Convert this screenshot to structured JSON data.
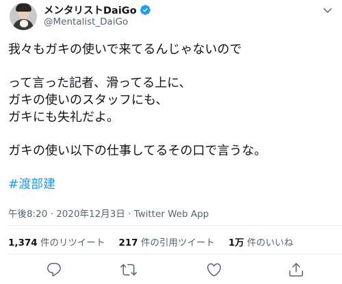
{
  "author": {
    "display_name": "メンタリストDaiGo",
    "handle": "@Mentalist_DaiGo",
    "verified": true
  },
  "tweet": {
    "lines": [
      "我々もガキの使いで来てるんじゃないので",
      "",
      "って言った記者、滑ってる上に、",
      "ガキの使いのスタッフにも、",
      "ガキにも失礼だよ。",
      "",
      "ガキの使い以下の仕事してるその口で言うな。",
      ""
    ],
    "hashtag": "#渡部建"
  },
  "meta": {
    "time": "午後8:20",
    "separator1": " · ",
    "date": "2020年12月3日",
    "separator2": " · ",
    "source": "Twitter Web App"
  },
  "stats": {
    "retweets_count": "1,374",
    "retweets_label": " 件のリツイート",
    "quotes_count": "217",
    "quotes_label": " 件の引用ツイート",
    "likes_count": "1万",
    "likes_label": " 件のいいね"
  },
  "icons": {
    "verified": "verified-badge-icon",
    "more": "chevron-down-icon",
    "reply": "reply-icon",
    "retweet": "retweet-icon",
    "like": "heart-icon",
    "share": "share-icon"
  },
  "colors": {
    "text": "#0f1419",
    "secondary_text": "#536471",
    "link": "#1d9bf0",
    "verified": "#1d9bf0",
    "divider": "#e6ecf0"
  }
}
